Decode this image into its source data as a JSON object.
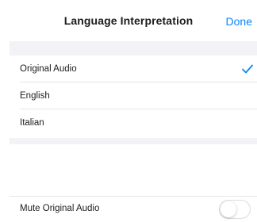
{
  "nav": {
    "title": "Language Interpretation",
    "done_label": "Done"
  },
  "languages": {
    "items": [
      {
        "label": "Original Audio",
        "selected": true
      },
      {
        "label": "English",
        "selected": false
      },
      {
        "label": "Italian",
        "selected": false
      }
    ]
  },
  "mute": {
    "label": "Mute Original Audio",
    "enabled": false
  },
  "colors": {
    "accent": "#0a84ff",
    "separator": "#e5e5ea",
    "group_background": "#f2f2f7"
  },
  "icons": {
    "selected": "checkmark-icon"
  }
}
